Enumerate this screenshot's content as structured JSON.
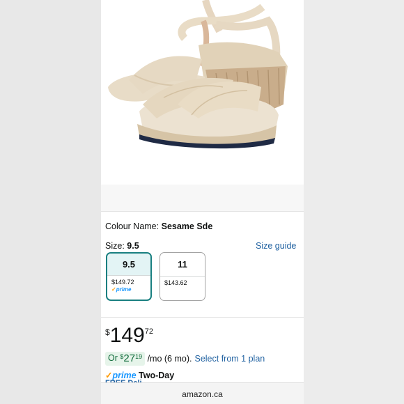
{
  "product": {
    "colour_label": "Colour Name:",
    "colour_value": "Sesame Sde",
    "size_label": "Size:",
    "size_value": "9.5",
    "size_guide": "Size guide",
    "sizes": [
      {
        "size": "9.5",
        "price": "$149.72",
        "prime": "prime",
        "selected": true
      },
      {
        "size": "11",
        "price": "$143.62",
        "selected": false
      }
    ],
    "price": {
      "symbol": "$",
      "whole": "149",
      "fraction": "72"
    },
    "monthly": {
      "prefix": "Or",
      "symbol": "$",
      "whole": "27",
      "fraction": "19",
      "suffix": "/mo (6 mo).",
      "plan_link": "Select from 1 plan"
    },
    "delivery": {
      "prime": "prime",
      "label": "Two-Day",
      "free": "FREE Deli"
    }
  },
  "browser": {
    "url": "amazon.ca"
  },
  "colors": {
    "accent": "#187f80",
    "link": "#2162a1",
    "prime": "#1a98ff"
  }
}
